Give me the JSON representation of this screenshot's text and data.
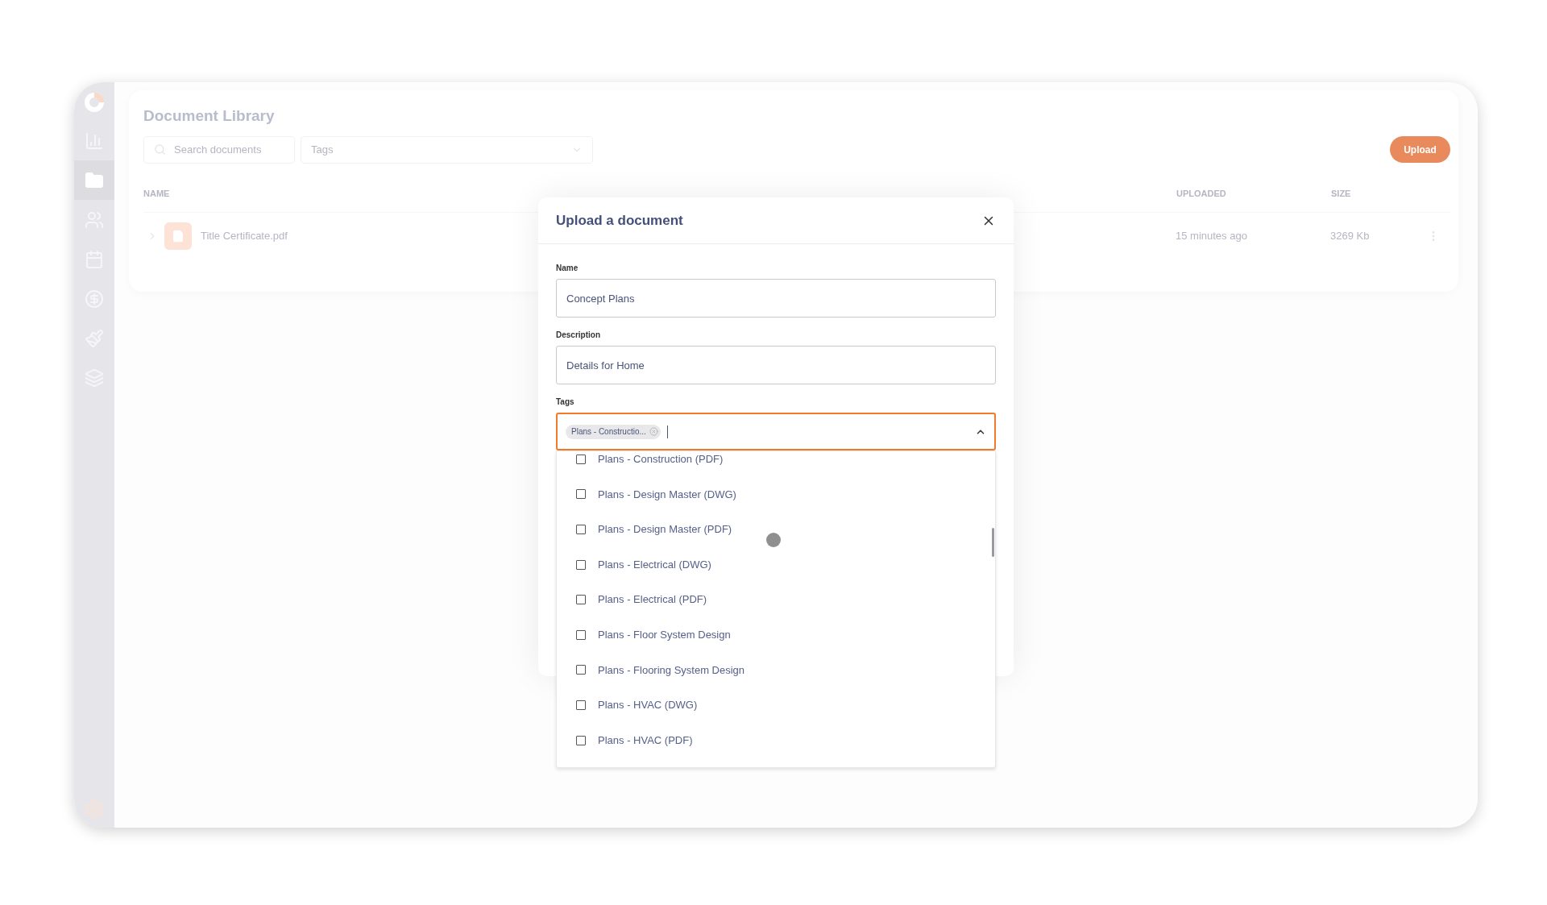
{
  "sidebar": {
    "items": [
      {
        "kind": "chart",
        "selected": false
      },
      {
        "kind": "folder",
        "selected": true
      },
      {
        "kind": "people",
        "selected": false
      },
      {
        "kind": "calendar",
        "selected": false
      },
      {
        "kind": "money",
        "selected": false
      },
      {
        "kind": "brush",
        "selected": false
      },
      {
        "kind": "layers",
        "selected": false
      }
    ]
  },
  "page": {
    "title": "Document Library",
    "search": {
      "placeholder": "Search documents"
    },
    "tags_filter": {
      "placeholder": "Tags"
    },
    "upload_button": "Upload"
  },
  "table": {
    "columns": [
      "NAME",
      "UPLOADED",
      "SIZE"
    ],
    "rows": [
      {
        "name": "Title Certificate.pdf",
        "uploaded": "15 minutes ago",
        "size": "3269 Kb"
      }
    ]
  },
  "modal": {
    "title": "Upload a document",
    "fields": [
      {
        "label": "Name",
        "value": "Concept Plans"
      },
      {
        "label": "Description",
        "value": "Details for Home"
      }
    ],
    "tags": {
      "label": "Tags",
      "expanded": true,
      "chips": [
        "Plans - Constructio..."
      ],
      "options": [
        {
          "label": "Plans - Construction (PDF)",
          "checked": false
        },
        {
          "label": "Plans - Design Master (DWG)",
          "checked": false
        },
        {
          "label": "Plans - Design Master (PDF)",
          "checked": false
        },
        {
          "label": "Plans - Electrical (DWG)",
          "checked": false
        },
        {
          "label": "Plans - Electrical (PDF)",
          "checked": false
        },
        {
          "label": "Plans - Floor System Design",
          "checked": false
        },
        {
          "label": "Plans - Flooring System Design",
          "checked": false
        },
        {
          "label": "Plans - HVAC (DWG)",
          "checked": false
        },
        {
          "label": "Plans - HVAC (PDF)",
          "checked": false
        }
      ]
    }
  }
}
